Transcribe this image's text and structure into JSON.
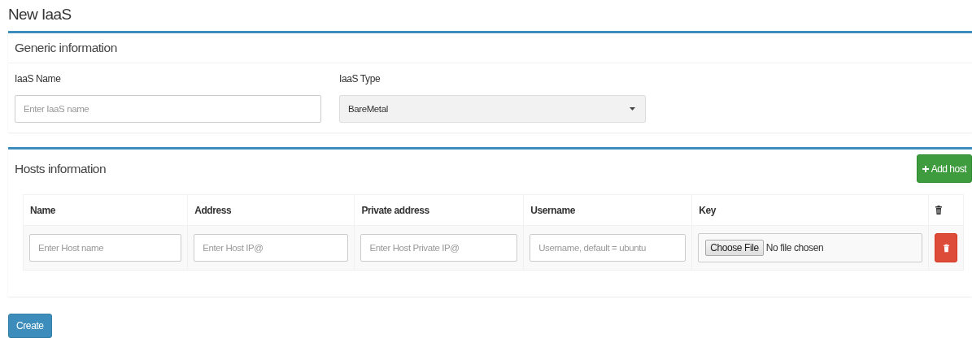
{
  "page_title": "New IaaS",
  "generic_panel": {
    "title": "Generic information",
    "fields": [
      {
        "kind": "text",
        "label": "IaaS Name",
        "placeholder": "Enter IaaS name"
      },
      {
        "kind": "select",
        "label": "IaaS Type",
        "value": "BareMetal"
      }
    ]
  },
  "hosts_panel": {
    "title": "Hosts information",
    "add_button": "Add host",
    "table": {
      "columns": [
        "Name",
        "Address",
        "Private address",
        "Username",
        "Key"
      ],
      "rows": [
        {
          "cells": [
            {
              "kind": "text",
              "placeholder": "Enter Host name"
            },
            {
              "kind": "text",
              "placeholder": "Enter Host IP@"
            },
            {
              "kind": "text",
              "placeholder": "Enter Host Private IP@"
            },
            {
              "kind": "text",
              "placeholder": "Username, default = ubuntu"
            },
            {
              "kind": "file",
              "button": "Choose File",
              "status": "No file chosen"
            }
          ]
        }
      ]
    }
  },
  "create_button": "Create"
}
